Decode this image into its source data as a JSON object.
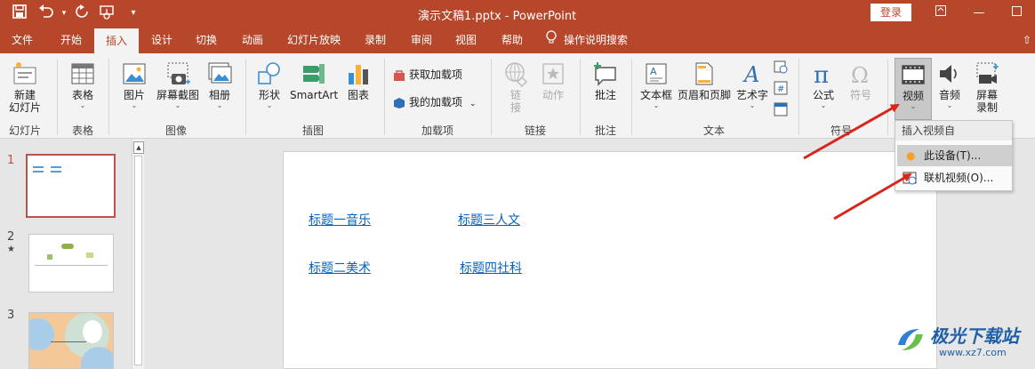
{
  "titlebar": {
    "title": "演示文稿1.pptx  -  PowerPoint",
    "login": "登录",
    "icons": [
      "save-icon",
      "undo-icon",
      "redo-icon",
      "present-icon",
      "customize-icon"
    ]
  },
  "tabs": [
    "文件",
    "开始",
    "插入",
    "设计",
    "切换",
    "动画",
    "幻灯片放映",
    "录制",
    "审阅",
    "视图",
    "帮助"
  ],
  "active_tab": "插入",
  "search_tab": "操作说明搜索",
  "ribbon": {
    "buttons": {
      "new_slide": "新建\n幻灯片",
      "table": "表格",
      "picture": "图片",
      "screenshot": "屏幕截图",
      "album": "相册",
      "shapes": "形状",
      "smartart": "SmartArt",
      "chart": "图表",
      "get_addins": "获取加载项",
      "my_addins": "我的加载项",
      "link": "链\n接",
      "action": "动作",
      "comment": "批注",
      "textbox": "文本框",
      "header_footer": "页眉和页脚",
      "wordart": "艺术字",
      "equation": "公式",
      "symbol": "符号",
      "video": "视频",
      "audio": "音频",
      "screen_record": "屏幕\n录制"
    },
    "groups": {
      "slides": "幻灯片",
      "tables": "表格",
      "images": "图像",
      "illustrations": "插图",
      "addins": "加载项",
      "links": "链接",
      "comments": "批注",
      "text": "文本",
      "symbols": "符号"
    }
  },
  "video_menu": {
    "header": "插入视频自",
    "items": [
      "此设备(T)...",
      "联机视频(O)..."
    ]
  },
  "slides_panel": {
    "numbers": [
      "1",
      "2",
      "3"
    ]
  },
  "slide": {
    "links": [
      "标题一音乐",
      "标题三人文",
      "标题二美术",
      "标题四社科"
    ]
  },
  "watermark": {
    "text": "极光下载站",
    "url": "www.xz7.com"
  },
  "colors": {
    "accent": "#b7472a",
    "link": "#0563c1",
    "arrow": "#d9251c"
  }
}
